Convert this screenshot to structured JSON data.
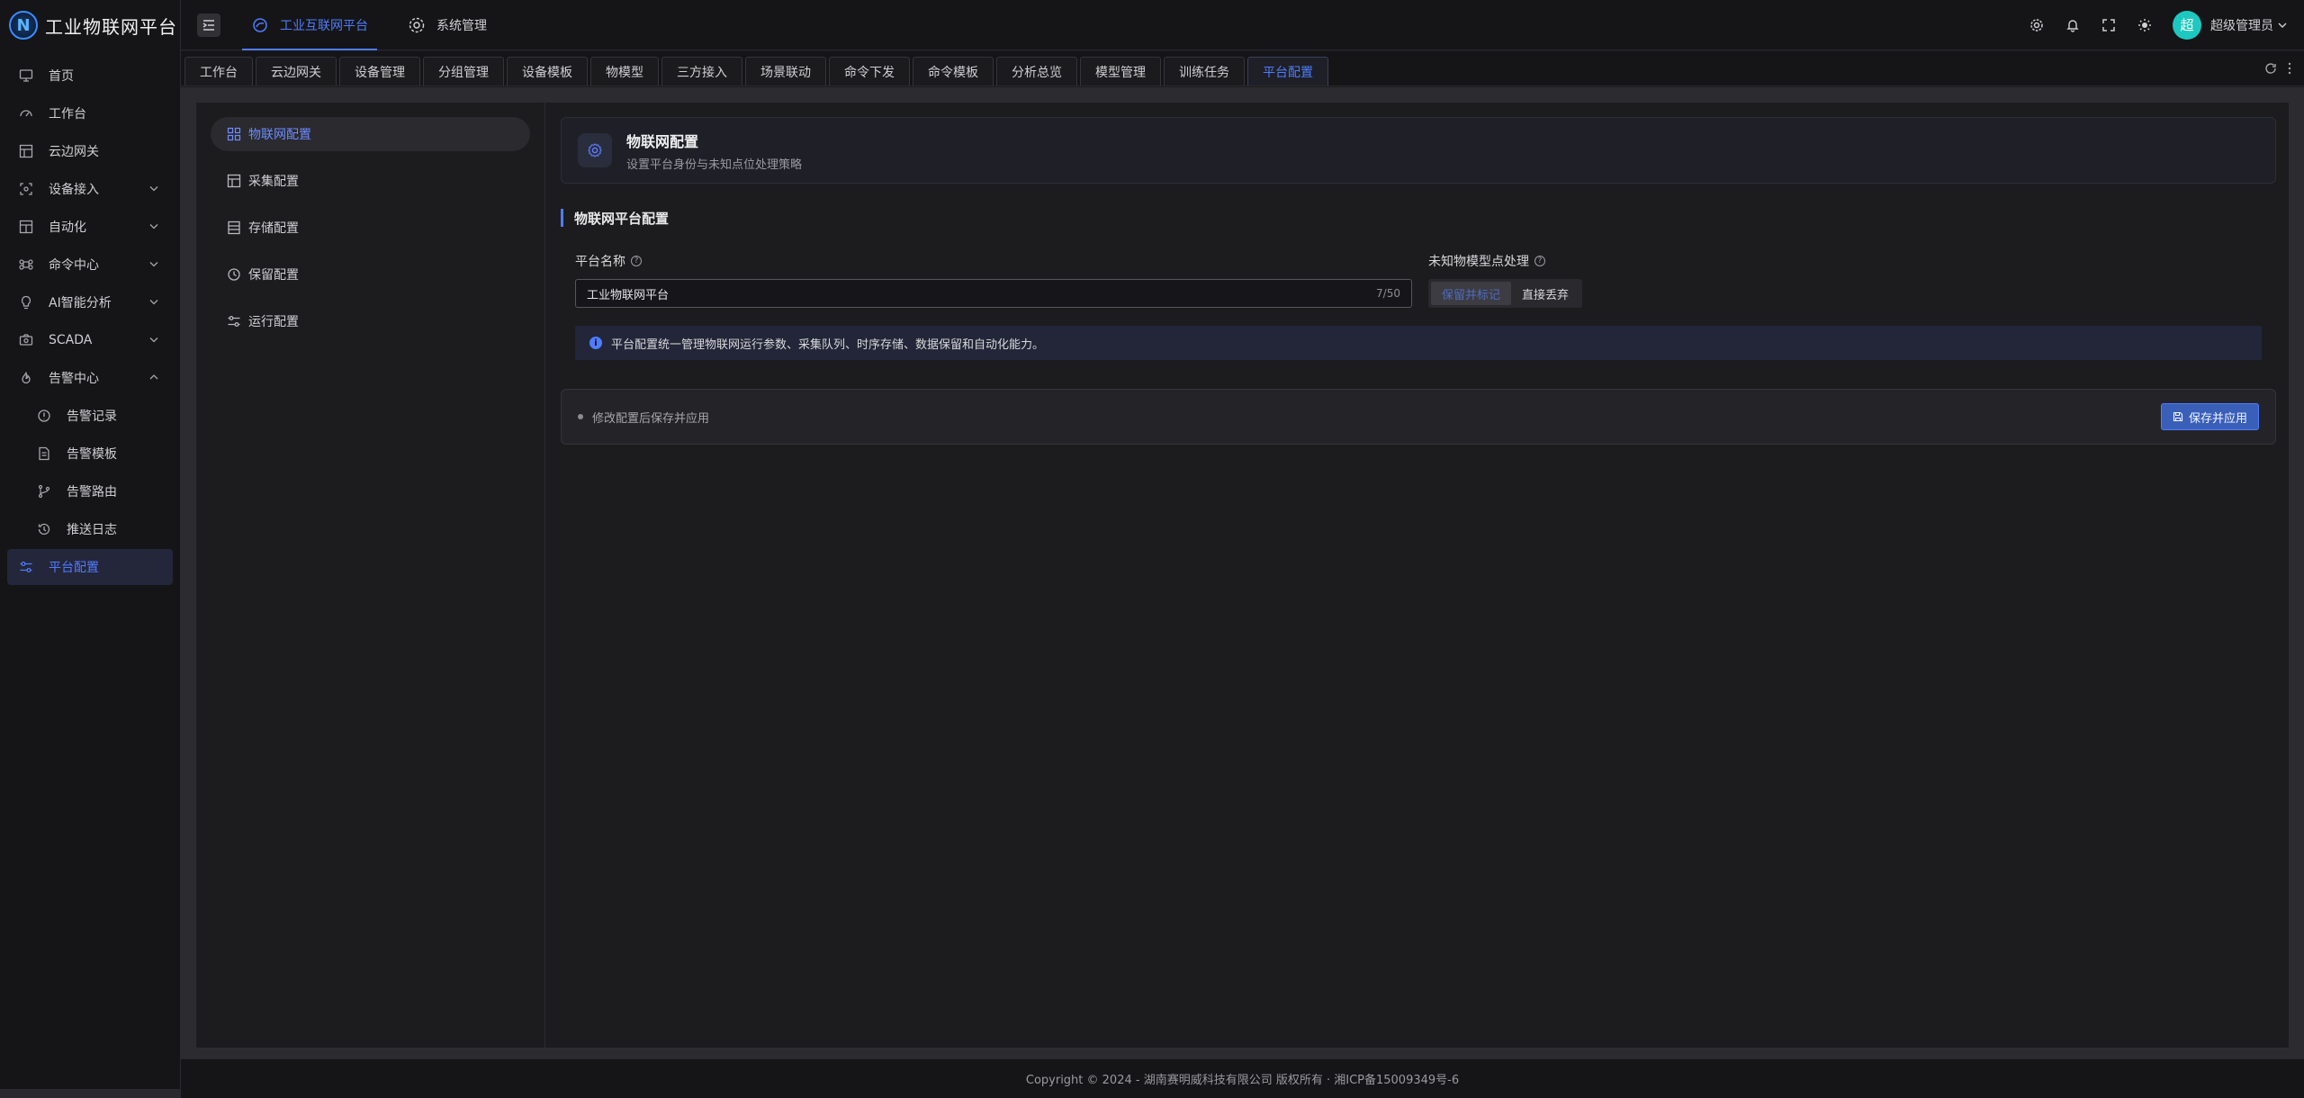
{
  "app": {
    "logo_letter": "N",
    "title": "工业物联网平台"
  },
  "sidebar": {
    "items": [
      {
        "label": "首页",
        "icon": "monitor-icon"
      },
      {
        "label": "工作台",
        "icon": "dashboard-icon"
      },
      {
        "label": "云边网关",
        "icon": "gateway-icon"
      },
      {
        "label": "设备接入",
        "icon": "device-icon",
        "expandable": true
      },
      {
        "label": "自动化",
        "icon": "automation-icon",
        "expandable": true
      },
      {
        "label": "命令中心",
        "icon": "command-icon",
        "expandable": true
      },
      {
        "label": "AI智能分析",
        "icon": "bulb-icon",
        "expandable": true
      },
      {
        "label": "SCADA",
        "icon": "scada-icon",
        "expandable": true
      },
      {
        "label": "告警中心",
        "icon": "fire-icon",
        "expandable": true,
        "expanded": true
      },
      {
        "label": "告警记录",
        "icon": "alert-circle-icon",
        "sub": true
      },
      {
        "label": "告警模板",
        "icon": "document-icon",
        "sub": true
      },
      {
        "label": "告警路由",
        "icon": "branch-icon",
        "sub": true
      },
      {
        "label": "推送日志",
        "icon": "history-icon",
        "sub": true
      },
      {
        "label": "平台配置",
        "icon": "sliders-icon",
        "active": true
      }
    ]
  },
  "topbar": {
    "tabs": [
      {
        "label": "工业互联网平台",
        "active": true
      },
      {
        "label": "系统管理",
        "active": false
      }
    ],
    "user": {
      "avatar_text": "超",
      "name": "超级管理员"
    }
  },
  "tags": [
    "工作台",
    "云边网关",
    "设备管理",
    "分组管理",
    "设备模板",
    "物模型",
    "三方接入",
    "场景联动",
    "命令下发",
    "命令模板",
    "分析总览",
    "模型管理",
    "训练任务",
    "平台配置"
  ],
  "active_tag": "平台配置",
  "config_nav": [
    {
      "label": "物联网配置",
      "icon": "grid-icon",
      "active": true
    },
    {
      "label": "采集配置",
      "icon": "layout-icon"
    },
    {
      "label": "存储配置",
      "icon": "storage-icon"
    },
    {
      "label": "保留配置",
      "icon": "clock-icon"
    },
    {
      "label": "运行配置",
      "icon": "sliders-icon"
    }
  ],
  "header_card": {
    "title": "物联网配置",
    "subtitle": "设置平台身份与未知点位处理策略"
  },
  "section": {
    "title": "物联网平台配置"
  },
  "form": {
    "platform_name": {
      "label": "平台名称",
      "value": "工业物联网平台",
      "counter": "7/50"
    },
    "unknown_point": {
      "label": "未知物模型点处理",
      "options": [
        "保留并标记",
        "直接丢弃"
      ],
      "selected": "保留并标记"
    }
  },
  "info_text": "平台配置统一管理物联网运行参数、采集队列、时序存储、数据保留和自动化能力。",
  "save_bar": {
    "hint": "修改配置后保存并应用",
    "button_label": "保存并应用"
  },
  "footer": {
    "text": "Copyright © 2024 - 湖南赛明威科技有限公司 版权所有 · 湘ICP备15009349号-6"
  },
  "colors": {
    "accent": "#4f7cff",
    "background": "#1b1b1d",
    "avatar": "#1ec8c0"
  }
}
